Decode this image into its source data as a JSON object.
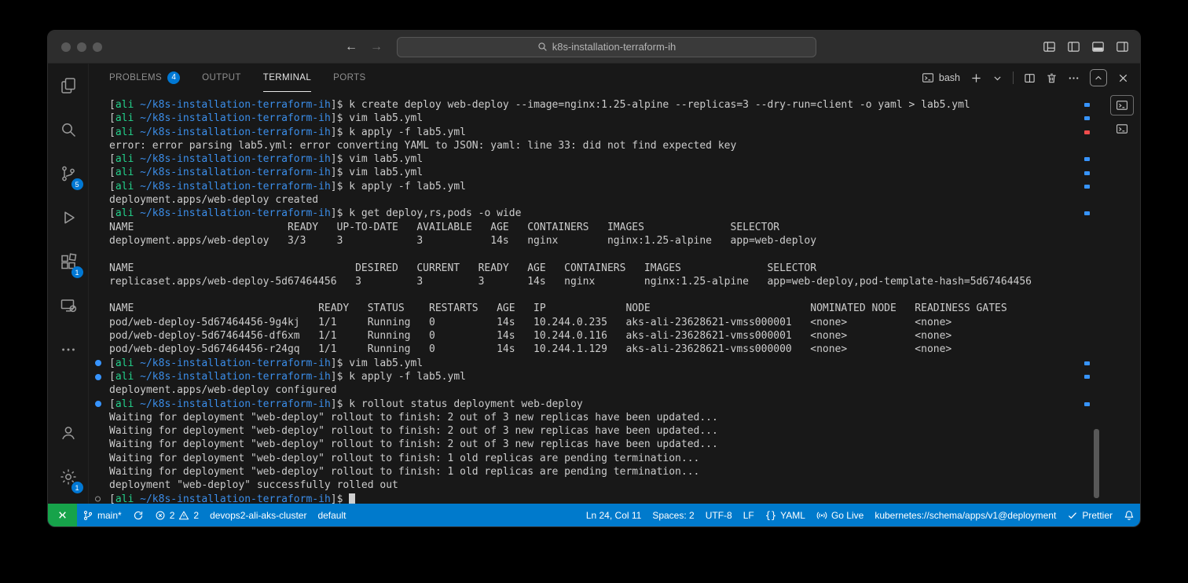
{
  "window": {
    "title_search": "k8s-installation-terraform-ih"
  },
  "colors": {
    "status_bar_bg": "#007acc",
    "remote_green": "#16a34a",
    "badge_blue": "#0078d4",
    "ansi_green": "#23d18b",
    "ansi_blue": "#3b8eea",
    "decoration_blue": "#3794ff",
    "decoration_red": "#f14c4c",
    "terminal_bg": "#181818"
  },
  "activity_bar": {
    "badges": {
      "source_control": "5",
      "extensions": "1",
      "settings": "1"
    }
  },
  "panel": {
    "tabs": [
      {
        "label": "PROBLEMS",
        "badge": "4"
      },
      {
        "label": "OUTPUT"
      },
      {
        "label": "TERMINAL"
      },
      {
        "label": "PORTS"
      }
    ],
    "shell_label": "bash"
  },
  "terminal": {
    "prompt": {
      "open": "[",
      "user": "ali",
      "path": "~/k8s-installation-terraform-ih",
      "close": "]$"
    },
    "lines": [
      {
        "cmd": "k create deploy web-deploy --image=nginx:1.25-alpine --replicas=3 --dry-run=client -o yaml > lab5.yml"
      },
      {
        "cmd": "vim lab5.yml"
      },
      {
        "cmd": "k apply -f lab5.yml"
      },
      {
        "out": "error: error parsing lab5.yml: error converting YAML to JSON: yaml: line 33: did not find expected key"
      },
      {
        "cmd": "vim lab5.yml"
      },
      {
        "cmd": "vim lab5.yml"
      },
      {
        "cmd": "k apply -f lab5.yml"
      },
      {
        "out": "deployment.apps/web-deploy created"
      },
      {
        "cmd": "k get deploy,rs,pods -o wide"
      },
      {
        "out": "NAME                         READY   UP-TO-DATE   AVAILABLE   AGE   CONTAINERS   IMAGES              SELECTOR"
      },
      {
        "out": "deployment.apps/web-deploy   3/3     3            3           14s   nginx        nginx:1.25-alpine   app=web-deploy"
      },
      {
        "out": ""
      },
      {
        "out": "NAME                                    DESIRED   CURRENT   READY   AGE   CONTAINERS   IMAGES              SELECTOR"
      },
      {
        "out": "replicaset.apps/web-deploy-5d67464456   3         3         3       14s   nginx        nginx:1.25-alpine   app=web-deploy,pod-template-hash=5d67464456"
      },
      {
        "out": ""
      },
      {
        "out": "NAME                              READY   STATUS    RESTARTS   AGE   IP             NODE                          NOMINATED NODE   READINESS GATES"
      },
      {
        "out": "pod/web-deploy-5d67464456-9g4kj   1/1     Running   0          14s   10.244.0.235   aks-ali-23628621-vmss000001   <none>           <none>"
      },
      {
        "out": "pod/web-deploy-5d67464456-df6xm   1/1     Running   0          14s   10.244.0.116   aks-ali-23628621-vmss000001   <none>           <none>"
      },
      {
        "out": "pod/web-deploy-5d67464456-r24gq   1/1     Running   0          14s   10.244.1.129   aks-ali-23628621-vmss000000   <none>           <none>"
      },
      {
        "cmd": "vim lab5.yml",
        "marker": "dot"
      },
      {
        "cmd": "k apply -f lab5.yml",
        "marker": "dot"
      },
      {
        "out": "deployment.apps/web-deploy configured"
      },
      {
        "cmd": "k rollout status deployment web-deploy",
        "marker": "dot"
      },
      {
        "out": "Waiting for deployment \"web-deploy\" rollout to finish: 2 out of 3 new replicas have been updated..."
      },
      {
        "out": "Waiting for deployment \"web-deploy\" rollout to finish: 2 out of 3 new replicas have been updated..."
      },
      {
        "out": "Waiting for deployment \"web-deploy\" rollout to finish: 2 out of 3 new replicas have been updated..."
      },
      {
        "out": "Waiting for deployment \"web-deploy\" rollout to finish: 1 old replicas are pending termination..."
      },
      {
        "out": "Waiting for deployment \"web-deploy\" rollout to finish: 1 old replicas are pending termination..."
      },
      {
        "out": "deployment \"web-deploy\" successfully rolled out"
      },
      {
        "cmd": "",
        "marker": "ring",
        "cursor": true
      }
    ],
    "ruler_marks": [
      {
        "line": 1,
        "status": "ok"
      },
      {
        "line": 2,
        "status": "ok"
      },
      {
        "line": 3,
        "status": "err"
      },
      {
        "line": 5,
        "status": "ok"
      },
      {
        "line": 6,
        "status": "ok"
      },
      {
        "line": 7,
        "status": "ok"
      },
      {
        "line": 9,
        "status": "ok"
      },
      {
        "line": 20,
        "status": "ok"
      },
      {
        "line": 21,
        "status": "ok"
      },
      {
        "line": 23,
        "status": "ok"
      }
    ]
  },
  "status_bar": {
    "branch": "main*",
    "errors": "2",
    "warnings": "2",
    "cluster": "devops2-ali-aks-cluster",
    "namespace": "default",
    "cursor_position": "Ln 24, Col 11",
    "indentation": "Spaces: 2",
    "encoding": "UTF-8",
    "eol": "LF",
    "language_icon": "{}",
    "language": "YAML",
    "go_live": "Go Live",
    "schema": "kubernetes://schema/apps/v1@deployment",
    "formatter": "Prettier"
  }
}
